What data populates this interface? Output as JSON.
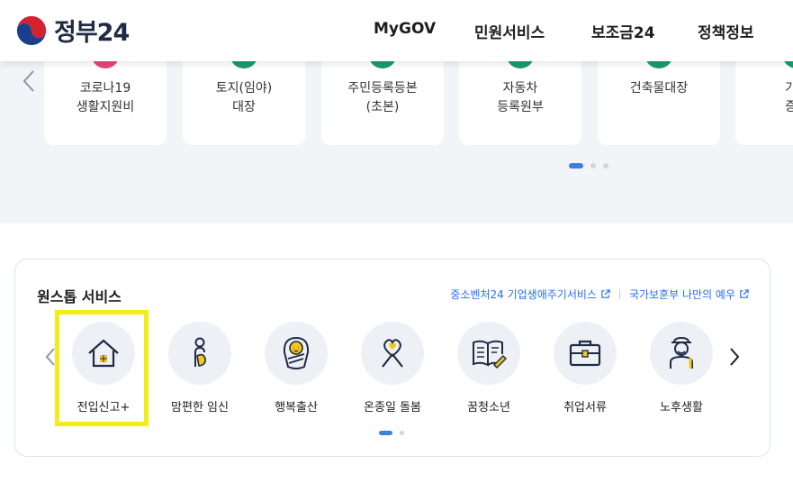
{
  "header": {
    "brand": "정부24",
    "nav": [
      "MyGOV",
      "민원서비스",
      "보조금24",
      "정책정보"
    ]
  },
  "popular": {
    "cards": [
      {
        "line1": "코로나19",
        "line2": "생활지원비",
        "icon_color": "#e8467f"
      },
      {
        "line1": "토지(임야)",
        "line2": "대장",
        "icon_color": "#1b9b6b"
      },
      {
        "line1": "주민등록등본",
        "line2": "(초본)",
        "icon_color": "#1b9b6b"
      },
      {
        "line1": "자동차",
        "line2": "등록원부",
        "icon_color": "#1b9b6b"
      },
      {
        "line1": "건축물대장",
        "line2": "",
        "icon_color": "#1b9b6b"
      },
      {
        "line1": "가족",
        "line2": "증명",
        "icon_color": "#1b9b6b"
      }
    ],
    "active_page": 1,
    "page_count": 3
  },
  "onestop": {
    "title": "원스톱 서비스",
    "links": [
      "중소벤처24 기업생애주기서비스",
      "국가보훈부 나만의 예우"
    ],
    "items": [
      {
        "label": "전입신고+",
        "icon": "house-icon"
      },
      {
        "label": "맘편한 임신",
        "icon": "pregnant-icon"
      },
      {
        "label": "행복출산",
        "icon": "baby-icon"
      },
      {
        "label": "온종일 돌봄",
        "icon": "ribbon-heart-icon"
      },
      {
        "label": "꿈청소년",
        "icon": "book-pencil-icon"
      },
      {
        "label": "취업서류",
        "icon": "briefcase-icon"
      },
      {
        "label": "노후생활",
        "icon": "elder-icon"
      }
    ],
    "active_page": 1,
    "page_count": 2
  },
  "colors": {
    "accent_blue": "#256ef4",
    "icon_yellow": "#f5c518",
    "icon_navy": "#1f2a44",
    "highlight": "#f4ec16"
  }
}
